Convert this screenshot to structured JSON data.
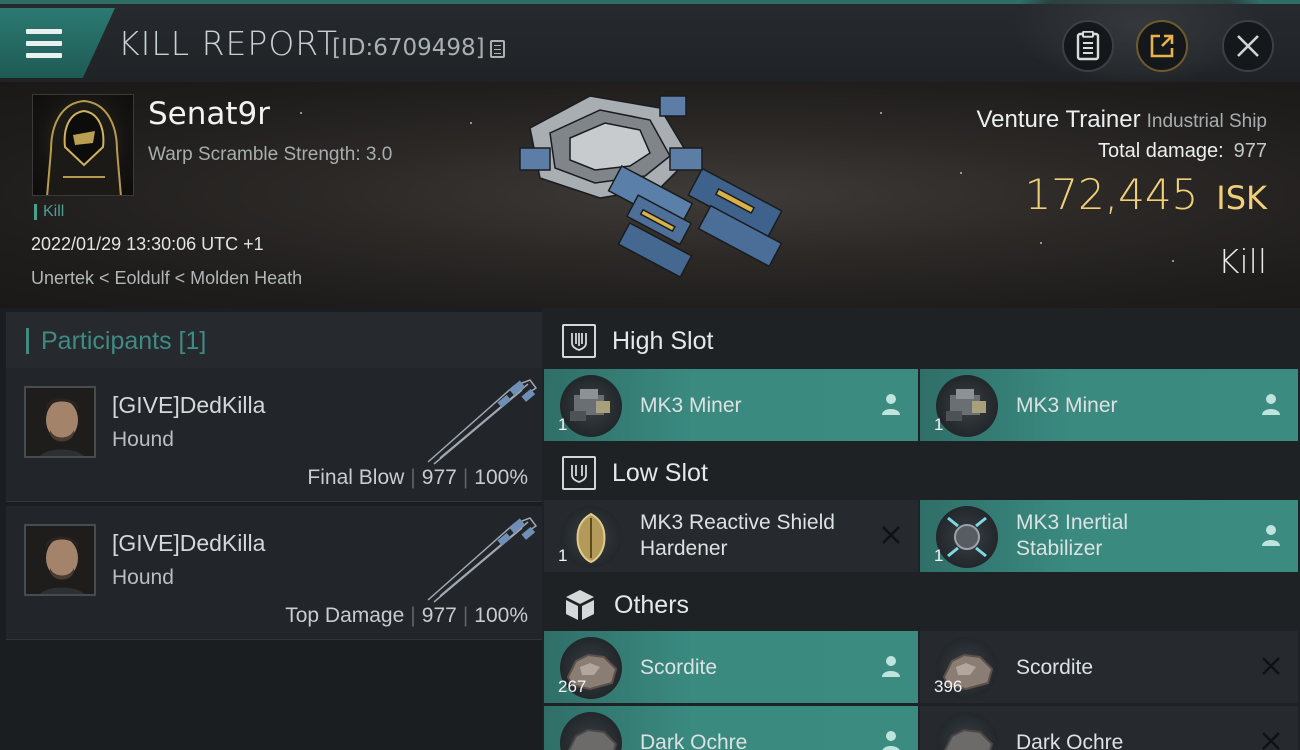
{
  "titlebar": {
    "title": "KILL REPORT",
    "id": "[ID:6709498]"
  },
  "victim": {
    "name": "Senat9r",
    "warp_scramble": "Warp Scramble Strength: 3.0",
    "tag": "Kill",
    "time": "2022/01/29 13:30:06 UTC +1",
    "location": "Unertek < Eoldulf < Molden Heath"
  },
  "ship": {
    "name": "Venture Trainer",
    "class": "Industrial Ship",
    "total_damage_label": "Total damage:",
    "total_damage": "977",
    "isk_value": "172,445",
    "isk_unit": "ISK",
    "result": "Kill"
  },
  "participants": {
    "title": "Participants [1]",
    "rows": [
      {
        "name": "[GIVE]DedKilla",
        "ship": "Hound",
        "role": "Final Blow",
        "damage": "977",
        "percent": "100%"
      },
      {
        "name": "[GIVE]DedKilla",
        "ship": "Hound",
        "role": "Top Damage",
        "damage": "977",
        "percent": "100%"
      }
    ]
  },
  "fitting": {
    "high": {
      "title": "High Slot",
      "items": [
        {
          "name": "MK3 Miner",
          "qty": "1",
          "status": "person-icon"
        },
        {
          "name": "MK3 Miner",
          "qty": "1",
          "status": "person-icon"
        }
      ]
    },
    "low": {
      "title": "Low Slot",
      "items": [
        {
          "name": "MK3 Reactive Shield Hardener",
          "qty": "1",
          "status": "destroyed-x-icon"
        },
        {
          "name": "MK3 Inertial Stabilizer",
          "qty": "1",
          "status": "person-icon"
        }
      ]
    },
    "others": {
      "title": "Others",
      "items": [
        {
          "name": "Scordite",
          "qty": "267",
          "status": "person-icon"
        },
        {
          "name": "Scordite",
          "qty": "396",
          "status": "destroyed-x-icon"
        },
        {
          "name": "Dark Ochre",
          "qty": "",
          "status": "person-icon"
        },
        {
          "name": "Dark Ochre",
          "qty": "",
          "status": "destroyed-x-icon"
        }
      ]
    }
  },
  "colors": {
    "accent_teal": "#3b8b81",
    "isk_gold": "#efcf79",
    "panel_dark": "#1f2225"
  }
}
